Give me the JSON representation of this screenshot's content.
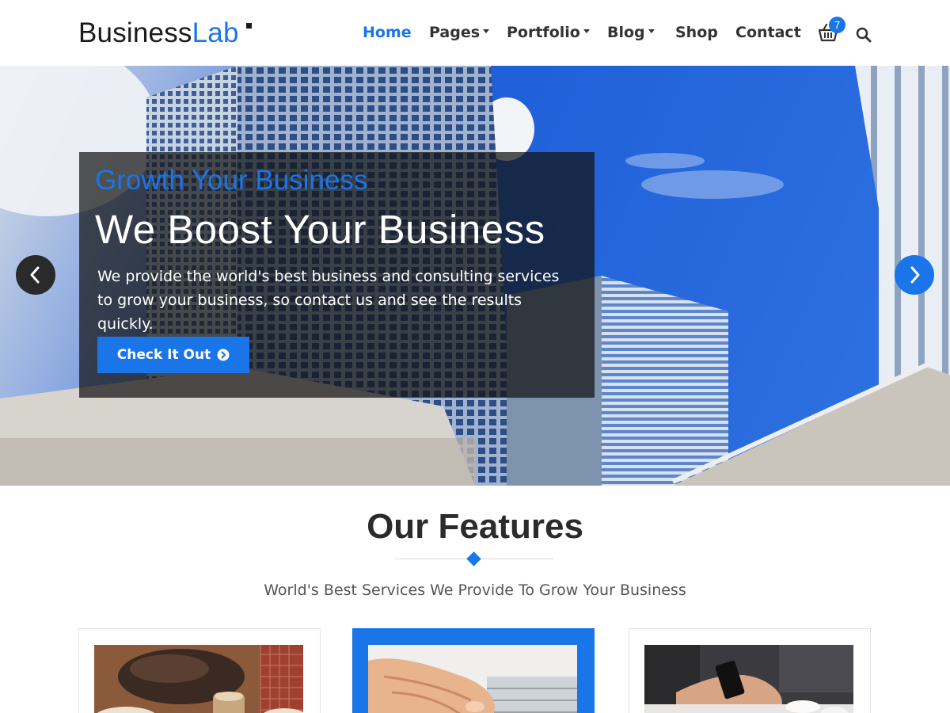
{
  "brand": {
    "part1": "Business",
    "part2": "Lab"
  },
  "nav": {
    "items": [
      {
        "label": "Home",
        "active": true,
        "dropdown": false
      },
      {
        "label": "Pages",
        "active": false,
        "dropdown": true
      },
      {
        "label": "Portfolio",
        "active": false,
        "dropdown": true
      },
      {
        "label": "Blog",
        "active": false,
        "dropdown": true
      },
      {
        "label": "Shop",
        "active": false,
        "dropdown": false
      },
      {
        "label": "Contact",
        "active": false,
        "dropdown": false
      }
    ],
    "cart_count": "7",
    "cart_icon": "basket-icon",
    "search_icon": "search-icon"
  },
  "hero": {
    "kicker": "Growth Your Business",
    "title": "We Boost Your Business",
    "text": "We provide the world's best business and consulting services to grow your business, so contact us and see the results quickly.",
    "button_label": "Check It Out",
    "button_icon": "chevron-circle-right-icon",
    "prev_icon": "chevron-left-icon",
    "next_icon": "chevron-right-icon"
  },
  "features": {
    "title": "Our Features",
    "subtitle": "World's Best Services We Provide To Grow Your Business",
    "cards": [
      {
        "image": "meeting-bag-photo",
        "active": false
      },
      {
        "image": "typing-keyboard-photo",
        "active": true
      },
      {
        "image": "phone-coffee-photo",
        "active": false
      }
    ]
  },
  "colors": {
    "accent": "#1a75e8",
    "text_dark": "#333333",
    "caption_bg": "rgba(20,20,20,0.72)"
  }
}
